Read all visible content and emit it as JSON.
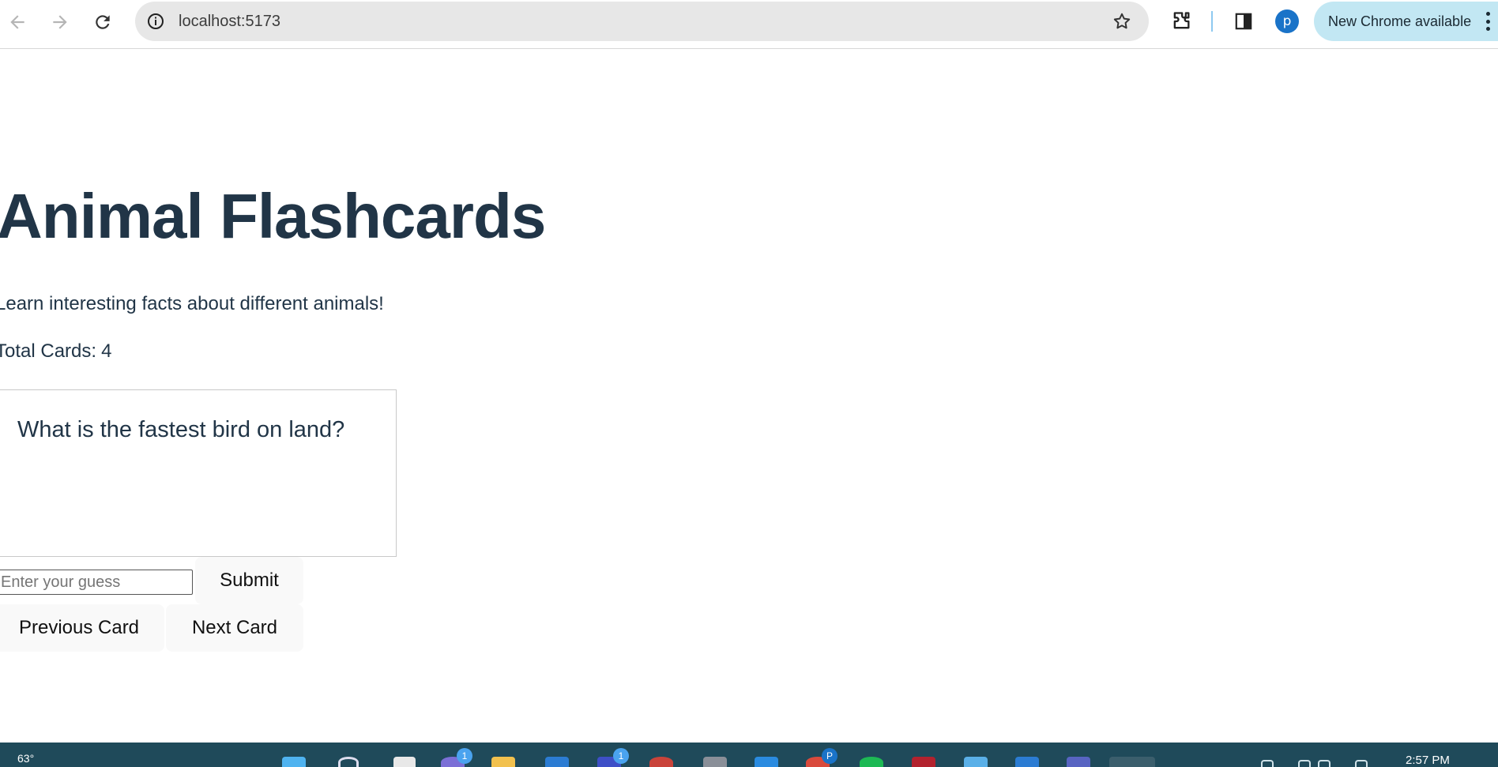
{
  "browser": {
    "url": "localhost:5173",
    "profile_initial": "p",
    "update_label": "New Chrome available",
    "icons": {
      "back": "arrow-left-icon",
      "forward": "arrow-right-icon",
      "reload": "reload-icon",
      "site_info": "info-icon",
      "bookmark": "star-icon",
      "extensions": "puzzle-icon",
      "side_panel": "side-panel-icon",
      "menu": "kebab-menu-icon"
    }
  },
  "app": {
    "title": "Animal Flashcards",
    "subtitle": "Learn interesting facts about different animals!",
    "total_label": "Total Cards:",
    "total_count": "4",
    "card_question": "What is the fastest bird on land?",
    "guess_placeholder": "Enter your guess",
    "submit_label": "Submit",
    "prev_label": "Previous Card",
    "next_label": "Next Card"
  },
  "taskbar": {
    "temperature": "63°",
    "clock": "2:57 PM",
    "badges": [
      "1",
      "1",
      "P"
    ]
  },
  "colors": {
    "heading": "#213547",
    "update_chip": "#c2e7f3",
    "avatar": "#1a73c8",
    "taskbar": "#1f4a5a",
    "button_bg": "#f9f9f9"
  }
}
